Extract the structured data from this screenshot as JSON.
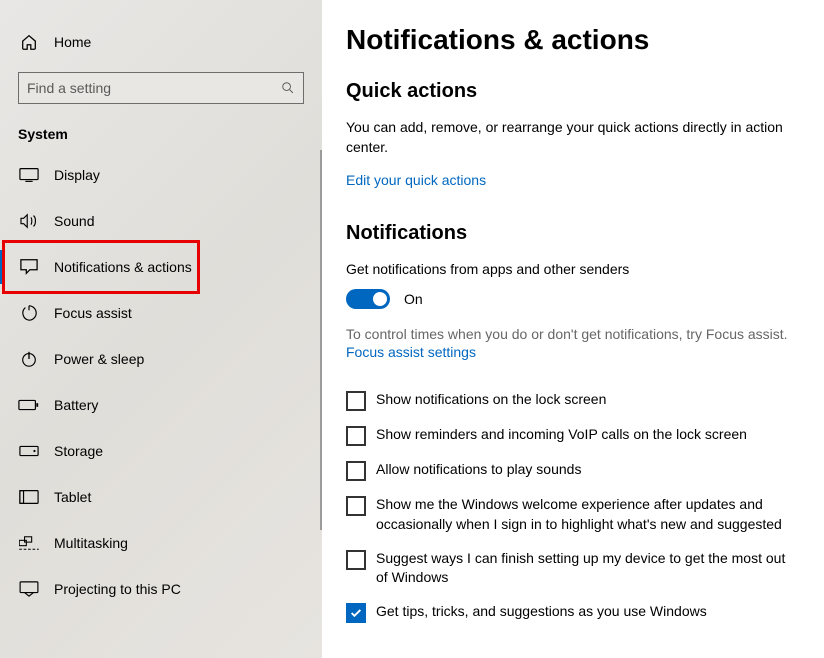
{
  "sidebar": {
    "home": "Home",
    "search_placeholder": "Find a setting",
    "section": "System",
    "items": [
      {
        "label": "Display"
      },
      {
        "label": "Sound"
      },
      {
        "label": "Notifications & actions"
      },
      {
        "label": "Focus assist"
      },
      {
        "label": "Power & sleep"
      },
      {
        "label": "Battery"
      },
      {
        "label": "Storage"
      },
      {
        "label": "Tablet"
      },
      {
        "label": "Multitasking"
      },
      {
        "label": "Projecting to this PC"
      }
    ]
  },
  "main": {
    "title": "Notifications & actions",
    "quick_actions": {
      "heading": "Quick actions",
      "desc": "You can add, remove, or rearrange your quick actions directly in action center.",
      "link": "Edit your quick actions"
    },
    "notifications": {
      "heading": "Notifications",
      "toggle_label": "Get notifications from apps and other senders",
      "toggle_state": "On",
      "focus_desc": "To control times when you do or don't get notifications, try Focus assist.",
      "focus_link": "Focus assist settings",
      "checks": [
        {
          "label": "Show notifications on the lock screen",
          "checked": false
        },
        {
          "label": "Show reminders and incoming VoIP calls on the lock screen",
          "checked": false
        },
        {
          "label": "Allow notifications to play sounds",
          "checked": false
        },
        {
          "label": "Show me the Windows welcome experience after updates and occasionally when I sign in to highlight what's new and suggested",
          "checked": false
        },
        {
          "label": "Suggest ways I can finish setting up my device to get the most out of Windows",
          "checked": false
        },
        {
          "label": "Get tips, tricks, and suggestions as you use Windows",
          "checked": true
        }
      ]
    }
  }
}
